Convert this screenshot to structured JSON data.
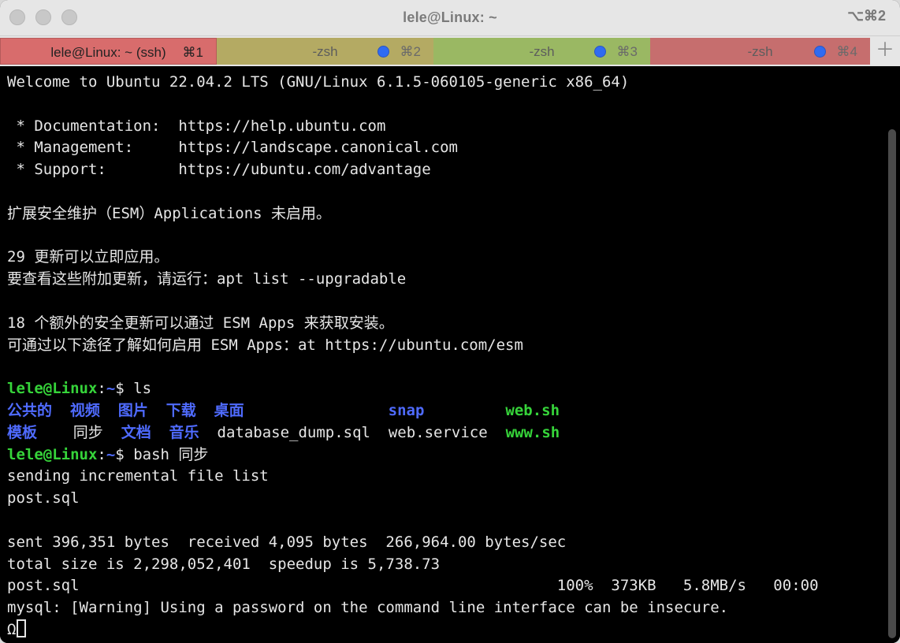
{
  "window": {
    "title": "lele@Linux: ~",
    "shortcut": "⌥⌘2"
  },
  "tabs": [
    {
      "label": "lele@Linux: ~ (ssh)",
      "shortcut": "⌘1",
      "color": "#d86c6c",
      "active": true
    },
    {
      "label": "-zsh",
      "shortcut": "⌘2",
      "color": "#b4aa63",
      "active": false
    },
    {
      "label": "-zsh",
      "shortcut": "⌘3",
      "color": "#9ab863",
      "active": false
    },
    {
      "label": "-zsh",
      "shortcut": "⌘4",
      "color": "#c66e6e",
      "active": false
    }
  ],
  "terminal": {
    "lines": [
      {
        "type": "text",
        "text": "Welcome to Ubuntu 22.04.2 LTS (GNU/Linux 6.1.5-060105-generic x86_64)"
      },
      {
        "type": "text",
        "text": ""
      },
      {
        "type": "text",
        "text": " * Documentation:  https://help.ubuntu.com"
      },
      {
        "type": "text",
        "text": " * Management:     https://landscape.canonical.com"
      },
      {
        "type": "text",
        "text": " * Support:        https://ubuntu.com/advantage"
      },
      {
        "type": "text",
        "text": ""
      },
      {
        "type": "text",
        "text": "扩展安全维护（ESM）Applications 未启用。"
      },
      {
        "type": "text",
        "text": ""
      },
      {
        "type": "text",
        "text": "29 更新可以立即应用。"
      },
      {
        "type": "text",
        "text": "要查看这些附加更新，请运行：apt list --upgradable"
      },
      {
        "type": "text",
        "text": ""
      },
      {
        "type": "text",
        "text": "18 个额外的安全更新可以通过 ESM Apps 来获取安装。"
      },
      {
        "type": "text",
        "text": "可通过以下途径了解如何启用 ESM Apps：at https://ubuntu.com/esm"
      },
      {
        "type": "text",
        "text": ""
      },
      {
        "type": "prompt",
        "user": "lele@Linux",
        "path": "~",
        "symbol": "$",
        "command": " ls"
      },
      {
        "type": "ls",
        "items": [
          {
            "text": "公共的",
            "style": "blue"
          },
          {
            "text": "  ",
            "style": "white"
          },
          {
            "text": "视频",
            "style": "blue"
          },
          {
            "text": "  ",
            "style": "white"
          },
          {
            "text": "图片",
            "style": "blue"
          },
          {
            "text": "  ",
            "style": "white"
          },
          {
            "text": "下载",
            "style": "blue"
          },
          {
            "text": "  ",
            "style": "white"
          },
          {
            "text": "桌面",
            "style": "blue"
          },
          {
            "text": "                ",
            "style": "white"
          },
          {
            "text": "snap",
            "style": "blue"
          },
          {
            "text": "         ",
            "style": "white"
          },
          {
            "text": "web.sh",
            "style": "green"
          }
        ]
      },
      {
        "type": "ls",
        "items": [
          {
            "text": "模板",
            "style": "blue"
          },
          {
            "text": "    ",
            "style": "white"
          },
          {
            "text": "同步",
            "style": "white"
          },
          {
            "text": "  ",
            "style": "white"
          },
          {
            "text": "文档",
            "style": "blue"
          },
          {
            "text": "  ",
            "style": "white"
          },
          {
            "text": "音乐",
            "style": "blue"
          },
          {
            "text": "  ",
            "style": "white"
          },
          {
            "text": "database_dump.sql",
            "style": "white"
          },
          {
            "text": "  ",
            "style": "white"
          },
          {
            "text": "web.service",
            "style": "white"
          },
          {
            "text": "  ",
            "style": "white"
          },
          {
            "text": "www.sh",
            "style": "green"
          }
        ]
      },
      {
        "type": "prompt",
        "user": "lele@Linux",
        "path": "~",
        "symbol": "$",
        "command": " bash 同步"
      },
      {
        "type": "text",
        "text": "sending incremental file list"
      },
      {
        "type": "text",
        "text": "post.sql"
      },
      {
        "type": "text",
        "text": ""
      },
      {
        "type": "text",
        "text": "sent 396,351 bytes  received 4,095 bytes  266,964.00 bytes/sec"
      },
      {
        "type": "text",
        "text": "total size is 2,298,052,401  speedup is 5,738.73"
      },
      {
        "type": "text",
        "text": "post.sql                                                     100%  373KB   5.8MB/s   00:00"
      },
      {
        "type": "text",
        "text": "mysql: [Warning] Using a password on the command line interface can be insecure."
      },
      {
        "type": "cursor",
        "text": "Ω"
      }
    ]
  }
}
